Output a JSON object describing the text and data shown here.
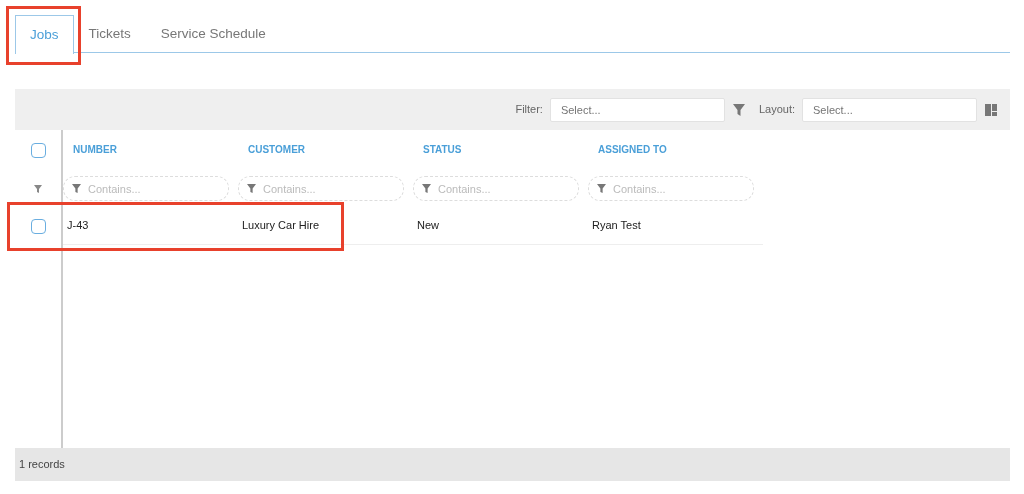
{
  "tabs": [
    {
      "label": "Jobs",
      "selected": true,
      "highlighted": true
    },
    {
      "label": "Tickets",
      "selected": false,
      "highlighted": false
    },
    {
      "label": "Service Schedule",
      "selected": false,
      "highlighted": false
    }
  ],
  "toolbar": {
    "filter_label": "Filter:",
    "filter_placeholder": "Select...",
    "layout_label": "Layout:",
    "layout_placeholder": "Select..."
  },
  "table": {
    "select_all_checked": false,
    "columns": [
      {
        "label": "NUMBER",
        "filter_placeholder": "Contains..."
      },
      {
        "label": "CUSTOMER",
        "filter_placeholder": "Contains..."
      },
      {
        "label": "STATUS",
        "filter_placeholder": "Contains..."
      },
      {
        "label": "ASSIGNED TO",
        "filter_placeholder": "Contains..."
      }
    ],
    "rows": [
      {
        "checked": false,
        "highlighted": true,
        "cells": [
          "J-43",
          "Luxury Car Hire",
          "New",
          "Ryan Test"
        ]
      }
    ]
  },
  "status_bar": "1 records"
}
